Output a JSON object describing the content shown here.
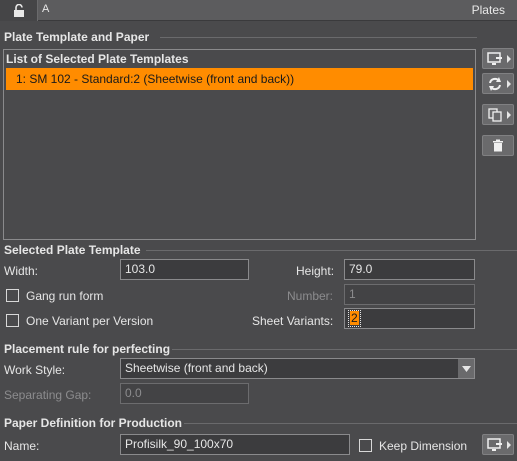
{
  "header": {
    "tab_label": "A",
    "title": "Plates"
  },
  "plate_template_section": {
    "title": "Plate Template and Paper",
    "list_header": "List of Selected Plate Templates",
    "items": [
      {
        "label": "1: SM 102 - Standard:2 (Sheetwise (front and back))",
        "selected": true
      }
    ]
  },
  "selected_plate_template": {
    "title": "Selected Plate Template",
    "width_label": "Width:",
    "width_value": "103.0",
    "height_label": "Height:",
    "height_value": "79.0",
    "gang_run_label": "Gang run form",
    "number_label": "Number:",
    "number_value": "1",
    "one_variant_label": "One Variant per Version",
    "sheet_variants_label": "Sheet Variants:",
    "sheet_variants_value": "2"
  },
  "placement_rule": {
    "title": "Placement rule for perfecting",
    "work_style_label": "Work Style:",
    "work_style_value": "Sheetwise (front and back)",
    "separating_gap_label": "Separating Gap:",
    "separating_gap_value": "0.0"
  },
  "paper_definition": {
    "title": "Paper Definition for Production",
    "name_label": "Name:",
    "name_value": "Profisilk_90_100x70",
    "keep_dimension_label": "Keep Dimension"
  },
  "colors": {
    "accent": "#ff8c00",
    "background": "#4a4a4c"
  },
  "icons": [
    "lock-open-icon",
    "monitor-add-icon",
    "refresh-icon",
    "copy-icon",
    "trash-icon",
    "caret-down-icon"
  ]
}
